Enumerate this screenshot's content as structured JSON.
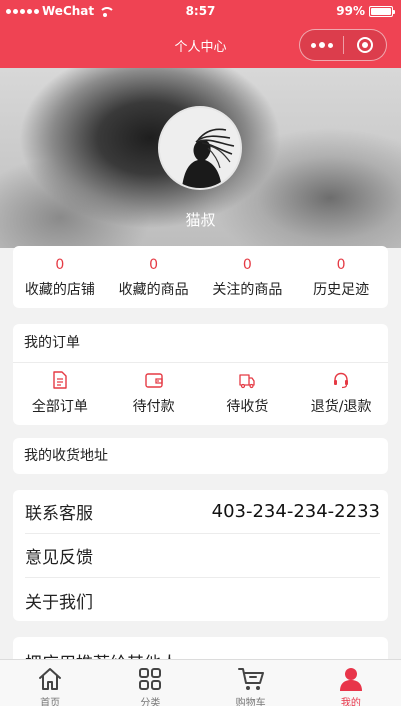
{
  "status_bar": {
    "carrier": "WeChat",
    "time": "8:57",
    "battery": "99%",
    "battery_level": 0.99
  },
  "nav": {
    "title": "个人中心"
  },
  "profile": {
    "username": "猫叔"
  },
  "stats": [
    {
      "count": "0",
      "label": "收藏的店铺"
    },
    {
      "count": "0",
      "label": "收藏的商品"
    },
    {
      "count": "0",
      "label": "关注的商品"
    },
    {
      "count": "0",
      "label": "历史足迹"
    }
  ],
  "orders": {
    "title": "我的订单",
    "items": [
      {
        "label": "全部订单",
        "icon": "document-icon"
      },
      {
        "label": "待付款",
        "icon": "wallet-icon"
      },
      {
        "label": "待收货",
        "icon": "truck-icon"
      },
      {
        "label": "退货/退款",
        "icon": "headset-icon"
      }
    ]
  },
  "address": {
    "label": "我的收货地址"
  },
  "menu": {
    "contact_label": "联系客服",
    "contact_phone": "403-234-234-2233",
    "feedback_label": "意见反馈",
    "about_label": "关于我们"
  },
  "recommend": {
    "label": "把应用推荐给其他人"
  },
  "tabbar": [
    {
      "label": "首页",
      "icon": "home-icon"
    },
    {
      "label": "分类",
      "icon": "category-icon"
    },
    {
      "label": "购物车",
      "icon": "cart-icon"
    },
    {
      "label": "我的",
      "icon": "user-icon"
    }
  ],
  "colors": {
    "accent": "#ef4353",
    "count": "#e53a44",
    "active_tab": "#e8354a"
  }
}
